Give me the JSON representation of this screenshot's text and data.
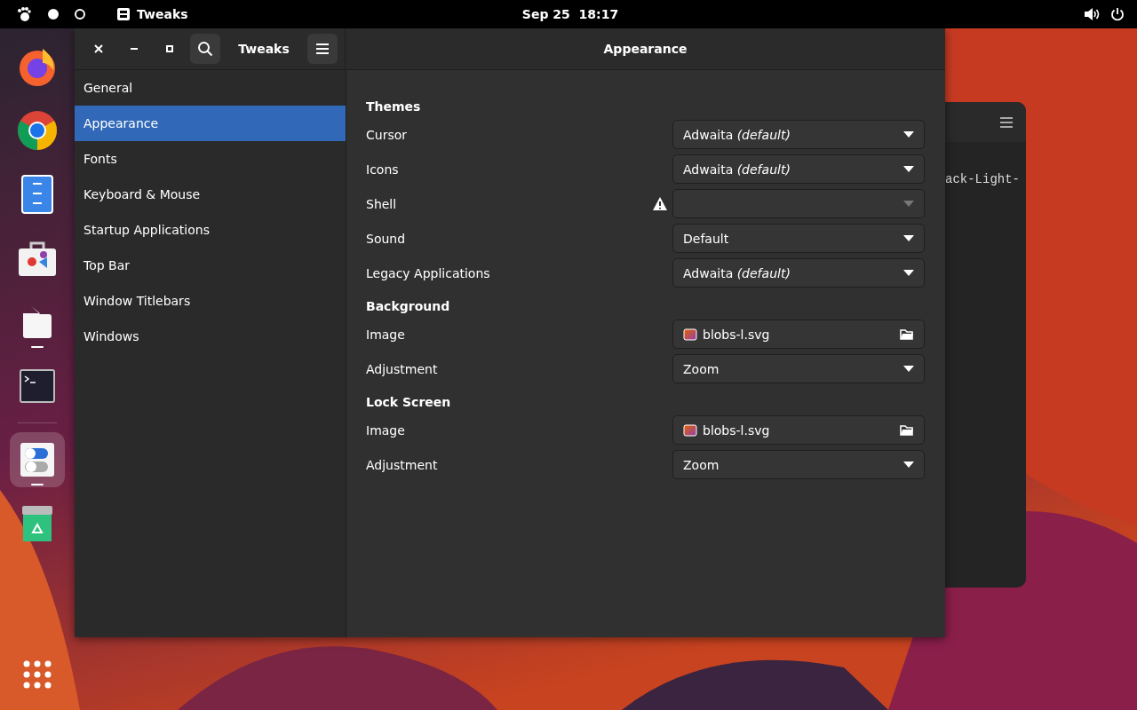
{
  "top_bar": {
    "workspaces": [
      {
        "selected": true
      },
      {
        "selected": false
      }
    ],
    "app_menu": "Tweaks",
    "clock": "Sep 25  18:17"
  },
  "dock": {
    "items": [
      {
        "running": false,
        "focused": false
      },
      {
        "running": false,
        "focused": false
      },
      {
        "running": false,
        "focused": false
      },
      {
        "running": false,
        "focused": false
      },
      {
        "running": true,
        "focused": false
      },
      {
        "running": false,
        "focused": false
      },
      {
        "running": true,
        "focused": true
      },
      {
        "running": false,
        "focused": false
      }
    ]
  },
  "background_window": {
    "text": "ack-Light-"
  },
  "window": {
    "app_title": "Tweaks",
    "page_title": "Appearance",
    "sidebar": {
      "items": [
        {
          "label": "General",
          "selected": false
        },
        {
          "label": "Appearance",
          "selected": true
        },
        {
          "label": "Fonts",
          "selected": false
        },
        {
          "label": "Keyboard & Mouse",
          "selected": false
        },
        {
          "label": "Startup Applications",
          "selected": false
        },
        {
          "label": "Top Bar",
          "selected": false
        },
        {
          "label": "Window Titlebars",
          "selected": false
        },
        {
          "label": "Windows",
          "selected": false
        }
      ]
    },
    "sections": [
      {
        "title": "Themes",
        "rows": [
          {
            "label": "Cursor",
            "kind": "dropdown",
            "value": "Adwaita *(default)*",
            "disabled": false,
            "warning": false
          },
          {
            "label": "Icons",
            "kind": "dropdown",
            "value": "Adwaita *(default)*",
            "disabled": false,
            "warning": false
          },
          {
            "label": "Shell",
            "kind": "dropdown",
            "disabled": true,
            "warning": true
          },
          {
            "label": "Sound",
            "kind": "dropdown",
            "value": "Default",
            "disabled": false,
            "warning": false
          },
          {
            "label": "Legacy Applications",
            "kind": "dropdown",
            "value": "Adwaita *(default)*",
            "disabled": false,
            "warning": false
          }
        ]
      },
      {
        "title": "Background",
        "rows": [
          {
            "label": "Image",
            "kind": "file",
            "value": "blobs-l.svg"
          },
          {
            "label": "Adjustment",
            "kind": "dropdown",
            "value": "Zoom",
            "disabled": false,
            "warning": false
          }
        ]
      },
      {
        "title": "Lock Screen",
        "rows": [
          {
            "label": "Image",
            "kind": "file",
            "value": "blobs-l.svg"
          },
          {
            "label": "Adjustment",
            "kind": "dropdown",
            "value": "Zoom",
            "disabled": false,
            "warning": false
          }
        ]
      }
    ]
  }
}
